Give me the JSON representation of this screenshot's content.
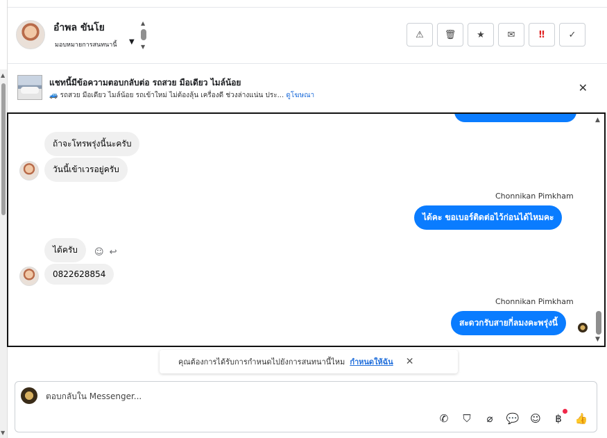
{
  "header": {
    "contact_name": "อำพล ขันโย",
    "assign_label": "มอบหมายการสนทนานี้",
    "actions": [
      {
        "name": "spam-button",
        "glyph": "⚠"
      },
      {
        "name": "delete-button",
        "glyph": "🗑"
      },
      {
        "name": "star-button",
        "glyph": "★"
      },
      {
        "name": "mail-button",
        "glyph": "✉"
      },
      {
        "name": "important-button",
        "glyph": "‼"
      },
      {
        "name": "done-button",
        "glyph": "✓"
      }
    ]
  },
  "banner": {
    "title": "แชทนี้มีข้อความตอบกลับต่อ รถสวย มือเดียว ไมล์น้อย",
    "subtitle": "🚙 รถสวย มือเดียว ไมล์น้อย รถเข้าใหม่ ไม่ต้องลุ้น เครื่องดี ช่วงล่างแน่น ประ...",
    "link": "ดูโฆษณา",
    "close": "✕"
  },
  "chat": {
    "messages": {
      "in1": "ถ้าจะโทรพรุ่งนี้นะครับ",
      "in2": "วันนี้เข้าเวรอยู่ครับ",
      "sender1": "Chonnikan Pimkham",
      "out1": "ได้คะ ขอเบอร์ติดต่อไว้ก่อนได้ไหมคะ",
      "in3": "ได้ครับ",
      "in4": "0822628854",
      "sender2": "Chonnikan Pimkham",
      "out2": "สะดวกรับสายกี่ลมงคะพรุ่งนี้"
    },
    "react_emoji": "☺",
    "reply_glyph": "↩"
  },
  "toast": {
    "text": "คุณต้องการได้รับการกำหนดไปยังการสนทนานี้ไหม",
    "link": "กำหนดให้ฉัน",
    "close": "✕"
  },
  "composer": {
    "placeholder": "ตอบกลับใน Messenger...",
    "tools": [
      {
        "name": "call-icon",
        "glyph": "✆"
      },
      {
        "name": "shopping-bag-icon",
        "glyph": "⛉"
      },
      {
        "name": "attachment-icon",
        "glyph": "⌀"
      },
      {
        "name": "saved-replies-icon",
        "glyph": "💬"
      },
      {
        "name": "emoji-icon",
        "glyph": "☺"
      },
      {
        "name": "payment-icon",
        "glyph": "฿"
      },
      {
        "name": "like-icon",
        "glyph": "👍"
      }
    ]
  },
  "colors": {
    "outgoing_bubble": "#0a7cff",
    "incoming_bubble": "#f0f0f0",
    "link": "#216fdb",
    "notification_dot": "#f02849"
  }
}
